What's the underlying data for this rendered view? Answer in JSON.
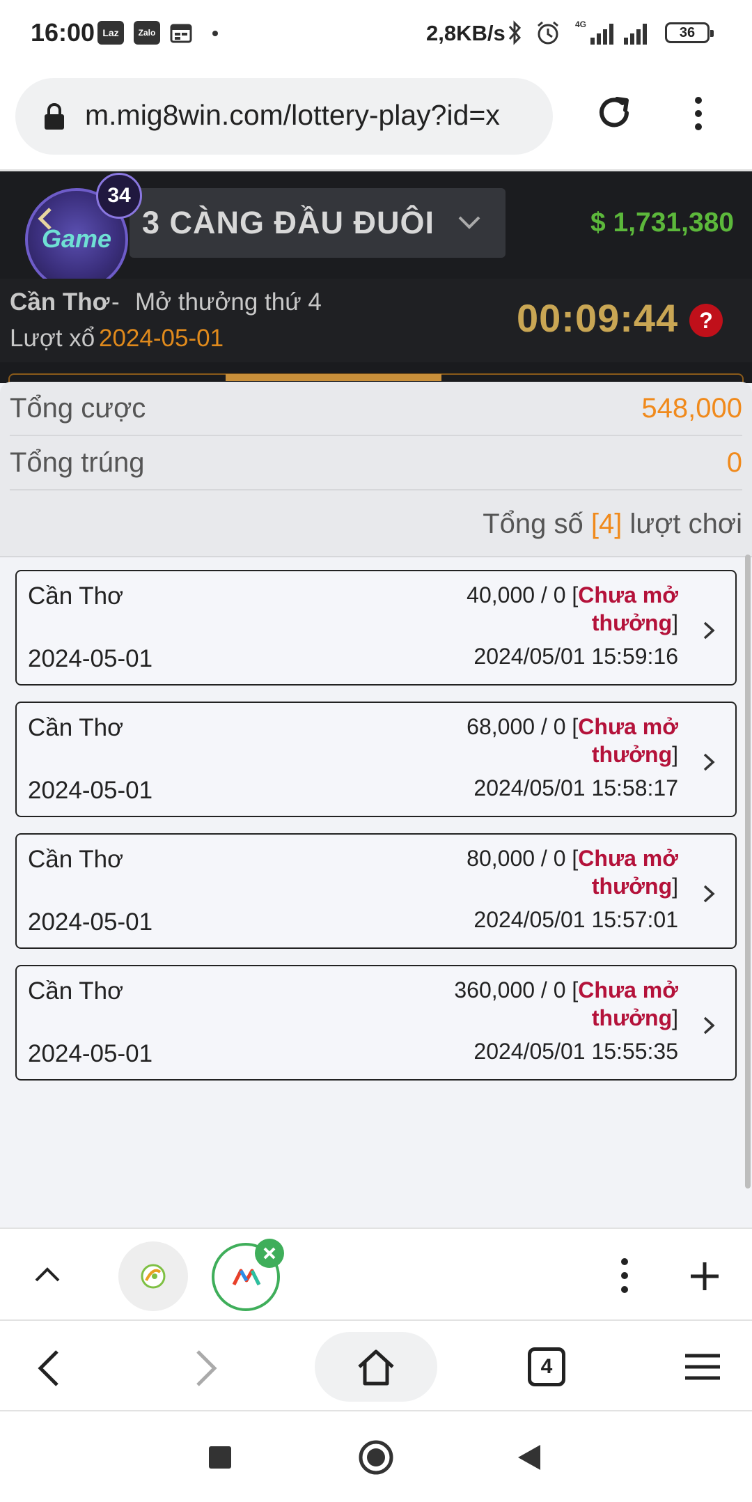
{
  "status_bar": {
    "time": "16:00",
    "notif_icons": [
      "Laz",
      "Zalo"
    ],
    "net_speed": "2,8KB/s",
    "network": "4G",
    "battery": "36"
  },
  "browser": {
    "url": "m.mig8win.com/lottery-play?id=x",
    "tab_count": "4"
  },
  "game": {
    "badge_count": "34",
    "logo_text": "Game",
    "title": "3 CÀNG ĐẦU ĐUÔI",
    "balance": "$ 1,731,380",
    "location": "Cần Thơ",
    "separator": "-",
    "round_label": "Mở thưởng thứ 4",
    "draw_label": "Lượt xổ",
    "draw_date": "2024-05-01",
    "countdown": "00:09:44",
    "help": "?"
  },
  "summary": {
    "total_bet_label": "Tổng cược",
    "total_bet_value": "548,000",
    "total_win_label": "Tổng trúng",
    "total_win_value": "0",
    "count_prefix": "Tổng số",
    "count_value": "[4]",
    "count_suffix": "lượt chơi"
  },
  "bets": [
    {
      "location": "Cần Thơ",
      "date": "2024-05-01",
      "amount": "40,000 / 0 [",
      "status": "Chưa mở thưởng",
      "close": "]",
      "time": "2024/05/01 15:59:16"
    },
    {
      "location": "Cần Thơ",
      "date": "2024-05-01",
      "amount": "68,000 / 0 [",
      "status": "Chưa mở thưởng",
      "close": "]",
      "time": "2024/05/01 15:58:17"
    },
    {
      "location": "Cần Thơ",
      "date": "2024-05-01",
      "amount": "80,000 / 0 [",
      "status": "Chưa mở thưởng",
      "close": "]",
      "time": "2024/05/01 15:57:01"
    },
    {
      "location": "Cần Thơ",
      "date": "2024-05-01",
      "amount": "360,000 / 0 [",
      "status": "Chưa mở thưởng",
      "close": "]",
      "time": "2024/05/01 15:55:35"
    }
  ],
  "colors": {
    "accent_orange": "#f08a1c",
    "status_red": "#b4123a",
    "balance_green": "#5cb83b",
    "countdown_gold": "#c9a654"
  }
}
